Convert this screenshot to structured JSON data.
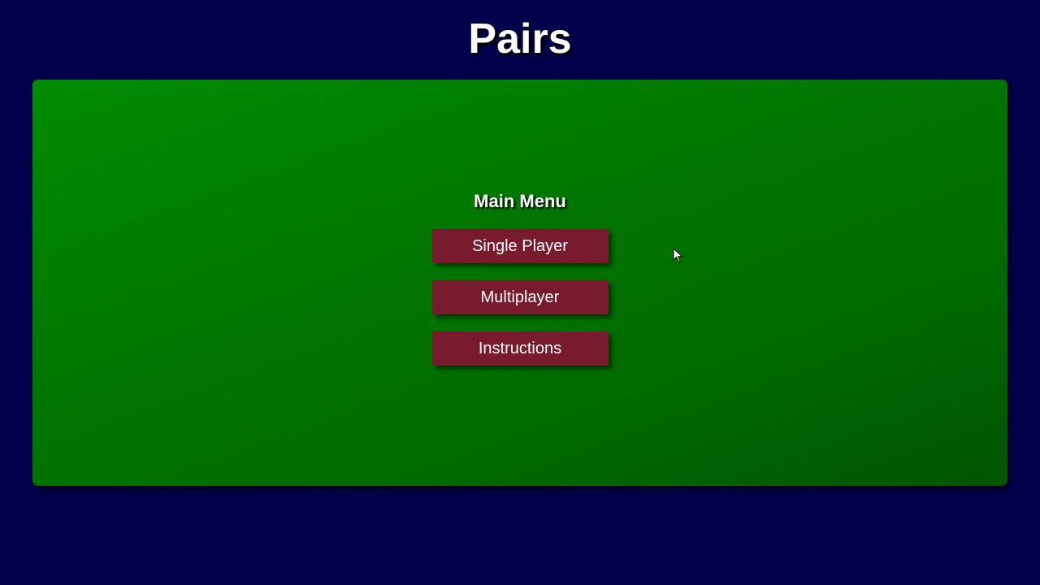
{
  "game": {
    "title": "Pairs"
  },
  "menu": {
    "heading": "Main Menu",
    "buttons": [
      {
        "label": "Single Player"
      },
      {
        "label": "Multiplayer"
      },
      {
        "label": "Instructions"
      }
    ]
  },
  "colors": {
    "background": "#00004b",
    "table_felt": "#007800",
    "button": "#7a1b2e",
    "text": "#ffffff"
  },
  "icons": {
    "cursor": "mouse-pointer-icon"
  }
}
